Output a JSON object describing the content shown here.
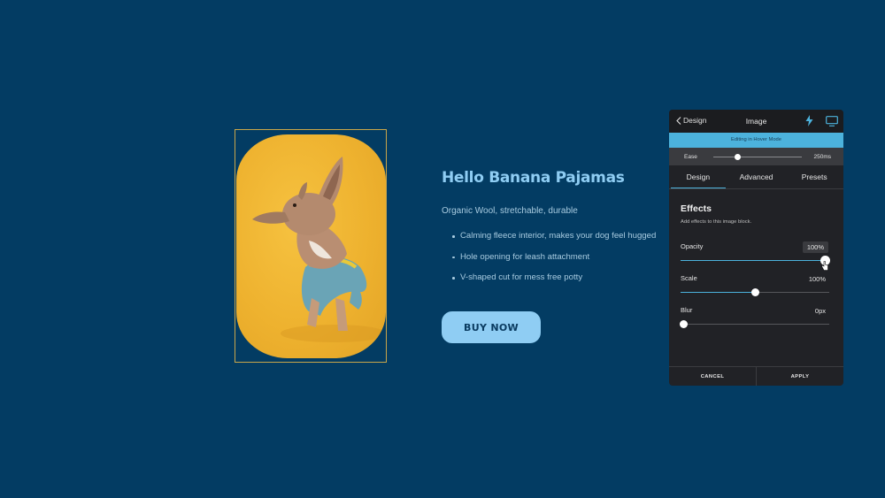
{
  "product": {
    "title": "Hello Banana  Pajamas",
    "subtitle": "Organic Wool, stretchable, durable",
    "bullets": [
      "Calming fleece interior, makes your dog feel hugged",
      "Hole opening for leash attachment",
      "V-shaped cut for mess free potty"
    ],
    "buy_label": "BUY NOW"
  },
  "panel": {
    "back_label": "Design",
    "title": "Image",
    "hover_mode_text": "Editing in Hover Mode",
    "ease": {
      "label": "Ease",
      "value": "250ms",
      "position": 0.27
    },
    "tabs": [
      "Design",
      "Advanced",
      "Presets"
    ],
    "active_tab": "Design",
    "effects": {
      "title": "Effects",
      "subtitle": "Add effects to this image block.",
      "controls": [
        {
          "label": "Opacity",
          "value": "100%",
          "level": 1.0
        },
        {
          "label": "Scale",
          "value": "100%",
          "level": 0.5
        },
        {
          "label": "Blur",
          "value": "0px",
          "level": 0.0
        }
      ]
    },
    "cancel_label": "CANCEL",
    "apply_label": "APPLY"
  },
  "colors": {
    "background": "#033c63",
    "accent_blue": "#8fcdf3",
    "panel_accent": "#4cb2dc",
    "image_yellow": "#eeb22f",
    "frame_gold": "#c9a64a"
  },
  "icons": [
    "chevron-left-icon",
    "bolt-icon",
    "monitor-icon",
    "cursor-icon"
  ]
}
